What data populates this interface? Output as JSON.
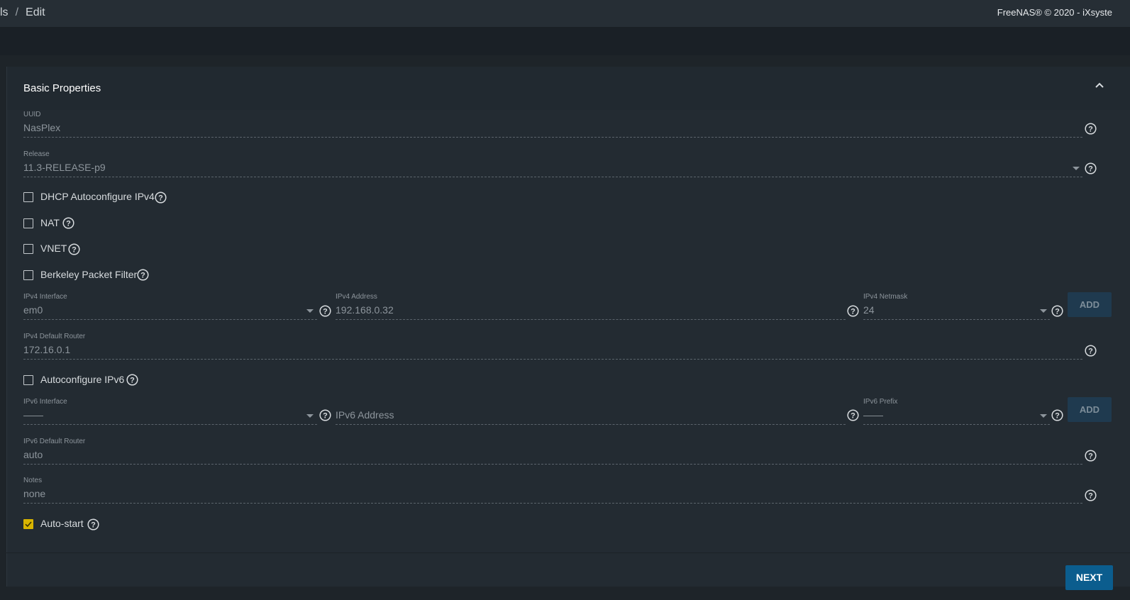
{
  "header": {
    "breadcrumb_prefix": "ls",
    "separator": "/",
    "breadcrumb_current": "Edit",
    "copyright": "FreeNAS® © 2020 - iXsyste"
  },
  "section": {
    "title": "Basic Properties"
  },
  "form": {
    "uuid": {
      "label": "UUID",
      "value": "NasPlex"
    },
    "release": {
      "label": "Release",
      "value": "11.3-RELEASE-p9"
    },
    "checkboxes": {
      "dhcp": {
        "label": "DHCP Autoconfigure IPv4",
        "checked": false
      },
      "nat": {
        "label": "NAT",
        "checked": false
      },
      "vnet": {
        "label": "VNET",
        "checked": false
      },
      "bpf": {
        "label": "Berkeley Packet Filter",
        "checked": false
      },
      "autoconf6": {
        "label": "Autoconfigure IPv6",
        "checked": false
      },
      "autostart": {
        "label": "Auto-start",
        "checked": true
      }
    },
    "ipv4_interface": {
      "label": "IPv4 Interface",
      "value": "em0"
    },
    "ipv4_address": {
      "label": "IPv4 Address",
      "value": "192.168.0.32"
    },
    "ipv4_netmask": {
      "label": "IPv4 Netmask",
      "value": "24"
    },
    "ipv4_default_router": {
      "label": "IPv4 Default Router",
      "value": "172.16.0.1"
    },
    "ipv6_interface": {
      "label": "IPv6 Interface",
      "value": "——"
    },
    "ipv6_address": {
      "placeholder": "IPv6 Address"
    },
    "ipv6_prefix": {
      "label": "IPv6 Prefix",
      "value": "——"
    },
    "ipv6_default_router": {
      "label": "IPv6 Default Router",
      "value": "auto"
    },
    "notes": {
      "label": "Notes",
      "value": "none"
    }
  },
  "buttons": {
    "add": "ADD",
    "next": "NEXT"
  },
  "colors": {
    "accent": "#0b5d8e",
    "checkbox_checked": "#d8b400"
  },
  "icons": {
    "help": "help-circle-icon",
    "collapse": "chevron-up-icon",
    "dropdown": "caret-down-icon"
  }
}
